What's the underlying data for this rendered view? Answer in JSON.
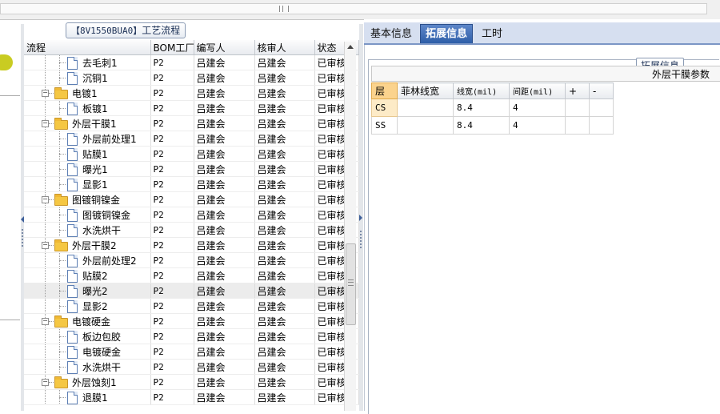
{
  "process_panel": {
    "title_code": "【8V1550BUA0】",
    "title_text": "工艺流程",
    "columns": [
      "流程",
      "BOM工厂",
      "编写人",
      "核审人",
      "状态"
    ],
    "rows": [
      {
        "label": "去毛刺1",
        "level": 2,
        "node": "leaf",
        "bom": "P2",
        "writer": "吕建会",
        "reviewer": "吕建会",
        "status": "已审核"
      },
      {
        "label": "沉铜1",
        "level": 2,
        "node": "leaf",
        "bom": "P2",
        "writer": "吕建会",
        "reviewer": "吕建会",
        "status": "已审核"
      },
      {
        "label": "电镀1",
        "level": 1,
        "node": "folder",
        "bom": "P2",
        "writer": "吕建会",
        "reviewer": "吕建会",
        "status": "已审核"
      },
      {
        "label": "板镀1",
        "level": 2,
        "node": "leaf",
        "bom": "P2",
        "writer": "吕建会",
        "reviewer": "吕建会",
        "status": "已审核"
      },
      {
        "label": "外层干膜1",
        "level": 1,
        "node": "folder",
        "bom": "P2",
        "writer": "吕建会",
        "reviewer": "吕建会",
        "status": "已审核"
      },
      {
        "label": "外层前处理1",
        "level": 2,
        "node": "leaf",
        "bom": "P2",
        "writer": "吕建会",
        "reviewer": "吕建会",
        "status": "已审核"
      },
      {
        "label": "贴膜1",
        "level": 2,
        "node": "leaf",
        "bom": "P2",
        "writer": "吕建会",
        "reviewer": "吕建会",
        "status": "已审核"
      },
      {
        "label": "曝光1",
        "level": 2,
        "node": "leaf",
        "bom": "P2",
        "writer": "吕建会",
        "reviewer": "吕建会",
        "status": "已审核"
      },
      {
        "label": "显影1",
        "level": 2,
        "node": "leaf",
        "bom": "P2",
        "writer": "吕建会",
        "reviewer": "吕建会",
        "status": "已审核"
      },
      {
        "label": "图镀铜镍金",
        "level": 1,
        "node": "folder",
        "bom": "P2",
        "writer": "吕建会",
        "reviewer": "吕建会",
        "status": "已审核"
      },
      {
        "label": "图镀铜镍金",
        "level": 2,
        "node": "leaf",
        "bom": "P2",
        "writer": "吕建会",
        "reviewer": "吕建会",
        "status": "已审核"
      },
      {
        "label": "水洗烘干",
        "level": 2,
        "node": "leaf",
        "bom": "P2",
        "writer": "吕建会",
        "reviewer": "吕建会",
        "status": "已审核"
      },
      {
        "label": "外层干膜2",
        "level": 1,
        "node": "folder",
        "bom": "P2",
        "writer": "吕建会",
        "reviewer": "吕建会",
        "status": "已审核"
      },
      {
        "label": "外层前处理2",
        "level": 2,
        "node": "leaf",
        "bom": "P2",
        "writer": "吕建会",
        "reviewer": "吕建会",
        "status": "已审核"
      },
      {
        "label": "贴膜2",
        "level": 2,
        "node": "leaf",
        "bom": "P2",
        "writer": "吕建会",
        "reviewer": "吕建会",
        "status": "已审核"
      },
      {
        "label": "曝光2",
        "level": 2,
        "node": "leaf",
        "bom": "P2",
        "writer": "吕建会",
        "reviewer": "吕建会",
        "status": "已审核",
        "selected": true
      },
      {
        "label": "显影2",
        "level": 2,
        "node": "leaf",
        "bom": "P2",
        "writer": "吕建会",
        "reviewer": "吕建会",
        "status": "已审核"
      },
      {
        "label": "电镀硬金",
        "level": 1,
        "node": "folder",
        "bom": "P2",
        "writer": "吕建会",
        "reviewer": "吕建会",
        "status": "已审核"
      },
      {
        "label": "板边包胶",
        "level": 2,
        "node": "leaf",
        "bom": "P2",
        "writer": "吕建会",
        "reviewer": "吕建会",
        "status": "已审核"
      },
      {
        "label": "电镀硬金",
        "level": 2,
        "node": "leaf",
        "bom": "P2",
        "writer": "吕建会",
        "reviewer": "吕建会",
        "status": "已审核"
      },
      {
        "label": "水洗烘干",
        "level": 2,
        "node": "leaf",
        "bom": "P2",
        "writer": "吕建会",
        "reviewer": "吕建会",
        "status": "已审核"
      },
      {
        "label": "外层蚀刻1",
        "level": 1,
        "node": "folder",
        "bom": "P2",
        "writer": "吕建会",
        "reviewer": "吕建会",
        "status": "已审核"
      },
      {
        "label": "退膜1",
        "level": 2,
        "node": "leaf",
        "bom": "P2",
        "writer": "吕建会",
        "reviewer": "吕建会",
        "status": "已审核"
      }
    ]
  },
  "tabs": [
    "基本信息",
    "拓展信息",
    "工时"
  ],
  "active_tab": 1,
  "extended_info": {
    "group_caption": "拓展信息",
    "param_title": "外层干膜参数",
    "columns": [
      "层",
      "菲林线宽",
      "线宽(mil)",
      "间距(mil)",
      "+",
      "-"
    ],
    "rows": [
      {
        "layer": "CS",
        "film_width": "",
        "line_width": "8.4",
        "spacing": "4",
        "plus": "",
        "minus": ""
      },
      {
        "layer": "SS",
        "film_width": "",
        "line_width": "8.4",
        "spacing": "4",
        "plus": "",
        "minus": ""
      }
    ]
  },
  "icons": {
    "folder": "folder-icon",
    "document": "document-icon",
    "collapse": "collapse-icon"
  },
  "colors": {
    "active_tab": "#3a69b3",
    "folder": "#f5c743",
    "selected_row": "#ececec",
    "header_highlight": "#fbd38d"
  }
}
